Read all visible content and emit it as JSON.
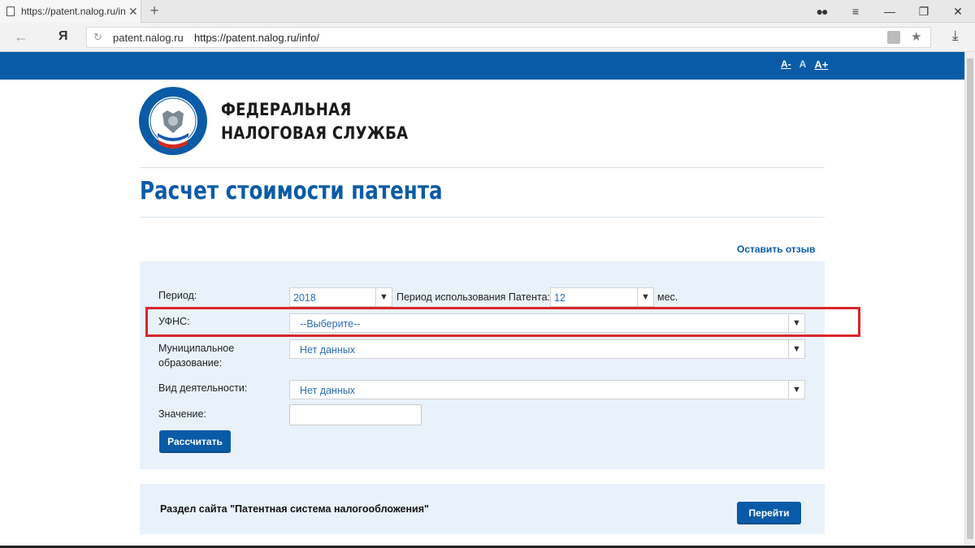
{
  "browser": {
    "tab_title": "https://patent.nalog.ru/in",
    "domain": "patent.nalog.ru",
    "url": "https://patent.nalog.ru/info/",
    "yandex_label": "Я"
  },
  "site": {
    "font_small": "A-",
    "font_normal": "A",
    "font_large": "A+",
    "org_line1": "ФЕДЕРАЛЬНАЯ",
    "org_line2": "НАЛОГОВАЯ СЛУЖБА",
    "page_title": "Расчет стоимости патента",
    "feedback_link": "Оставить отзыв",
    "brand_color": "#0a5ba7",
    "highlight_color": "#d9262c"
  },
  "form": {
    "period_label": "Период:",
    "period_value": "2018",
    "usage_label": "Период использования Патента:",
    "usage_value": "12",
    "usage_unit": "мес.",
    "ufns_label": "УФНС:",
    "ufns_value": "--Выберите--",
    "municipal_label_1": "Муниципальное",
    "municipal_label_2": "образование:",
    "municipal_value": "Нет данных",
    "activity_label": "Вид деятельности:",
    "activity_value": "Нет данных",
    "value_label": "Значение:",
    "value_input": "",
    "calc_button": "Рассчитать"
  },
  "section": {
    "text": "Раздел сайта \"Патентная система налогообложения\"",
    "go_button": "Перейти"
  }
}
